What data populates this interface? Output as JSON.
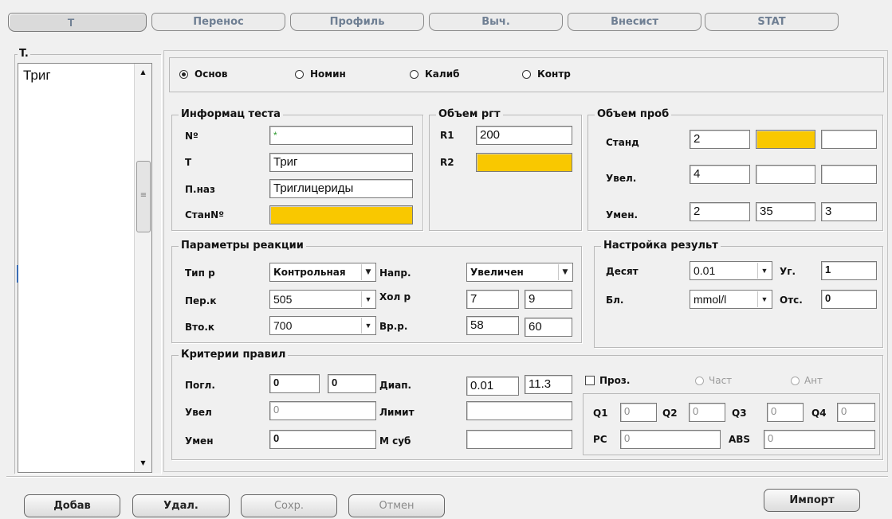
{
  "tabs": [
    "T",
    "Перенос",
    "Профиль",
    "Выч.",
    "Внесист",
    "STAT"
  ],
  "left_panel": {
    "title": "T.",
    "items": [
      "Триг"
    ]
  },
  "modes": {
    "options": [
      "Основ",
      "Номин",
      "Калиб",
      "Контр"
    ],
    "selected": "Основ"
  },
  "test_info": {
    "title": "Информац теста",
    "no_label": "Nº",
    "no_value": "*",
    "t_label": "T",
    "t_value": "Триг",
    "name_label": "П.наз",
    "name_value": "Триглицериды",
    "std_label": "СтанNº",
    "std_value": ""
  },
  "reagent": {
    "title": "Объем ргт",
    "r1_label": "R1",
    "r1_value": "200",
    "r2_label": "R2",
    "r2_value": ""
  },
  "sample": {
    "title": "Объем проб",
    "rows": [
      {
        "label": "Станд",
        "v1": "2",
        "v2": "",
        "v3": ""
      },
      {
        "label": "Увел.",
        "v1": "4",
        "v2": "",
        "v3": ""
      },
      {
        "label": "Умен.",
        "v1": "2",
        "v2": "35",
        "v3": "3"
      }
    ]
  },
  "reaction": {
    "title": "Параметры реакции",
    "type_label": "Тип р",
    "type_value": "Контрольная",
    "dir_label": "Напр.",
    "dir_value": "Увеличен",
    "first_label": "Пер.к",
    "first_value": "505",
    "cold_label": "Хол р",
    "cold_v1": "7",
    "cold_v2": "9",
    "second_label": "Вто.к",
    "second_value": "700",
    "time_label": "Вр.р.",
    "time_v1": "58",
    "time_v2": "60"
  },
  "result": {
    "title": "Настройка результ",
    "dec_label": "Десят",
    "dec_value": "0.01",
    "angle_label": "Уг.",
    "angle_value": "1",
    "unit_label": "Бл.",
    "unit_value": "mmol/l",
    "offset_label": "Отс.",
    "offset_value": "0"
  },
  "criteria": {
    "title": "Критерии правил",
    "abs_label": "Погл.",
    "abs_v1": "0",
    "abs_v2": "0",
    "range_label": "Диап.",
    "range_v1": "0.01",
    "range_v2": "11.3",
    "inc_label": "Увел",
    "inc_value": "0",
    "limit_label": "Лимит",
    "limit_value": "",
    "dec_label": "Умен",
    "dec_value": "0",
    "msub_label": "М суб",
    "msub_value": "",
    "transp_label": "Проз.",
    "part_label": "Част",
    "ant_label": "Ант",
    "q1_label": "Q1",
    "q1": "0",
    "q2_label": "Q2",
    "q2": "0",
    "q3_label": "Q3",
    "q3": "0",
    "q4_label": "Q4",
    "q4": "0",
    "pc_label": "PC",
    "pc": "0",
    "absv_label": "ABS",
    "absv": "0"
  },
  "buttons": {
    "add": "Добав",
    "delete": "Удал.",
    "save": "Сохр.",
    "cancel": "Отмен",
    "import": "Импорт"
  },
  "colors": {
    "highlight": "#f9c800",
    "tab_text": "#6f7f93"
  }
}
